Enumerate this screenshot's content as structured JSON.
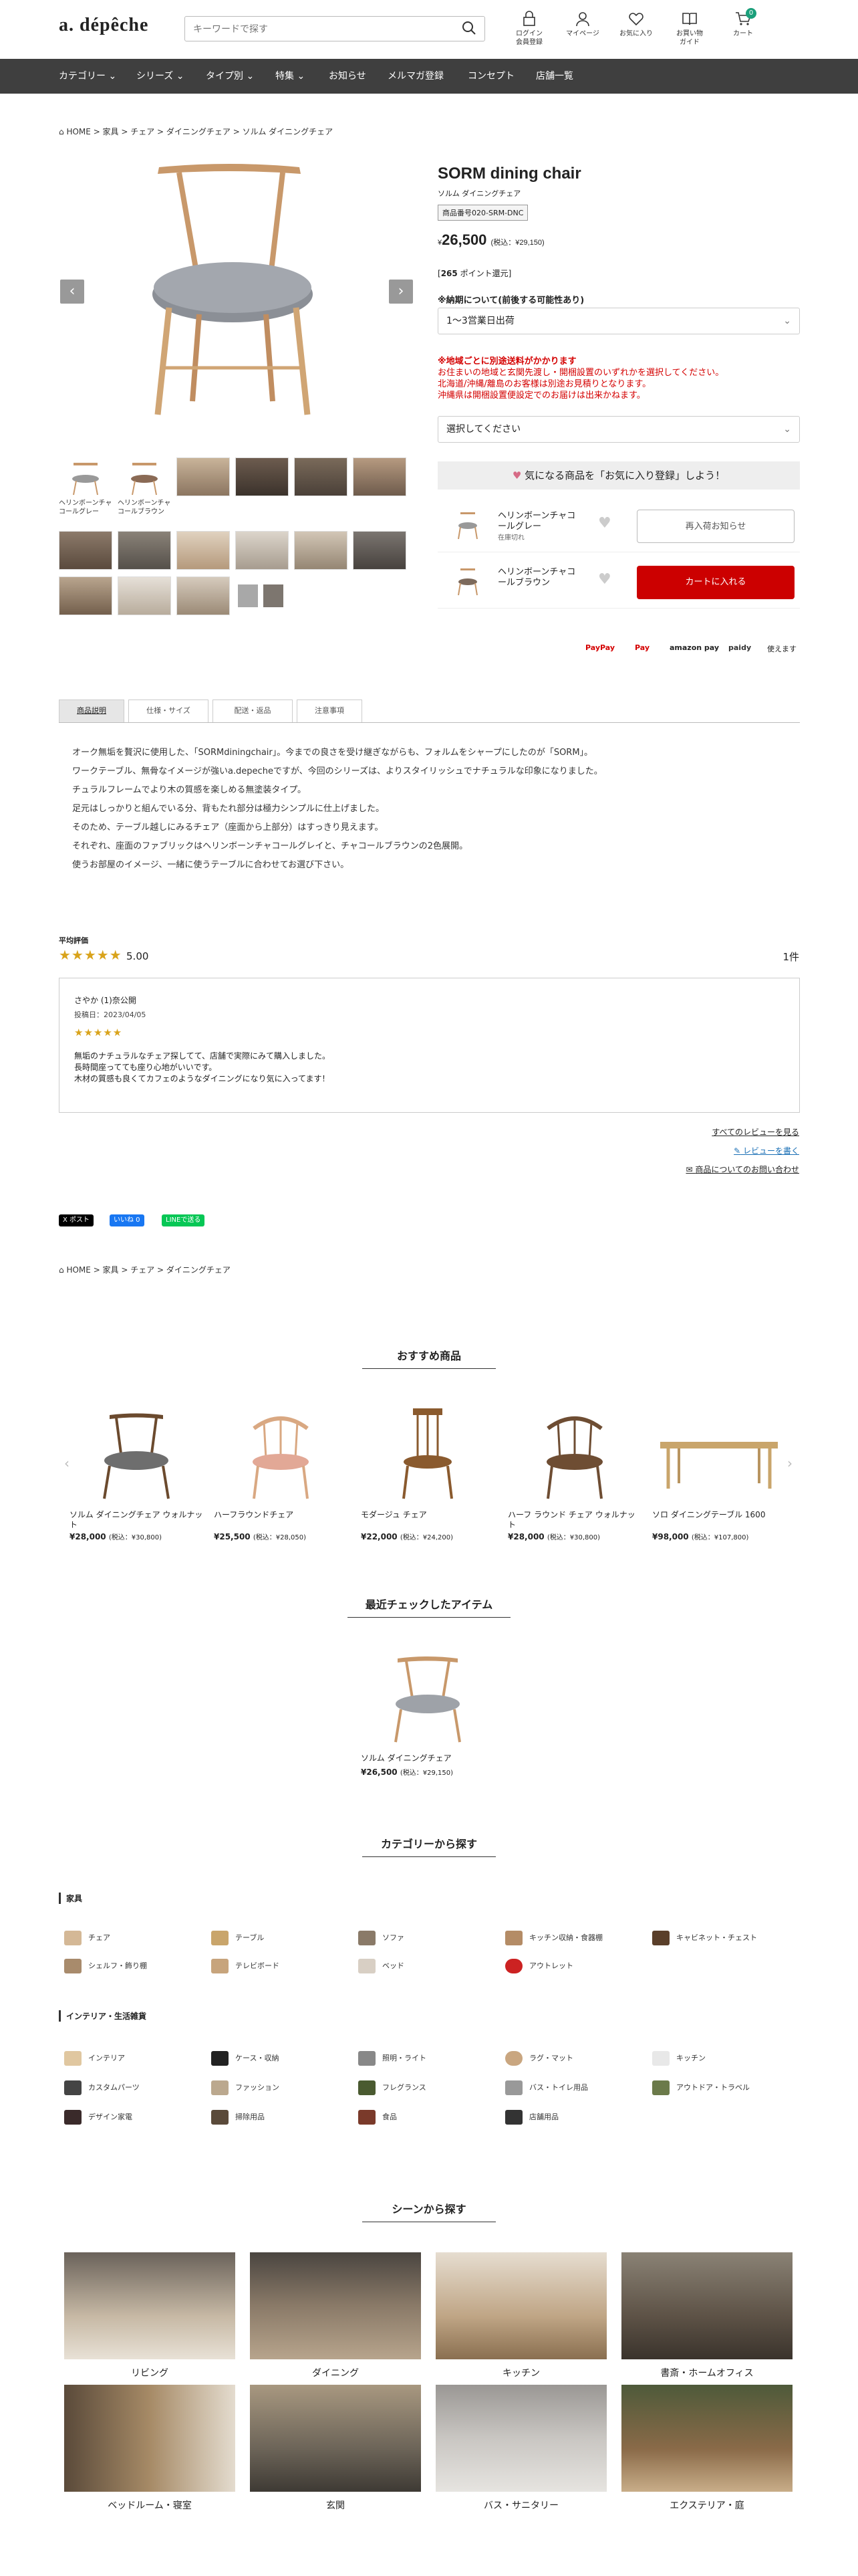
{
  "header": {
    "logo": "a. dépêche",
    "search_placeholder": "キーワードで探す",
    "icons": [
      {
        "label": "ログイン\n会員登録",
        "icon": "lock-icon"
      },
      {
        "label": "マイページ",
        "icon": "user-icon"
      },
      {
        "label": "お気に入り",
        "icon": "heart-icon"
      },
      {
        "label": "お買い物\nガイド",
        "icon": "book-icon"
      },
      {
        "label": "カート",
        "icon": "cart-icon"
      }
    ],
    "cart_count": "0"
  },
  "nav": [
    "カテゴリー",
    "シリーズ",
    "タイプ別",
    "特集",
    "お知らせ",
    "メルマガ登録",
    "コンセプト",
    "店舗一覧"
  ],
  "breadcrumb": {
    "home": "HOME",
    "items": "> 家具 > チェア > ダイニングチェア > ソルム ダイニングチェア"
  },
  "product": {
    "name": "SORM dining chair",
    "kana": "ソルム ダイニングチェア",
    "code": "商品番号020-SRM-DNC",
    "price_symbol": "¥",
    "price": "26,500",
    "price_tax": "(税込：¥29,150)",
    "points_num": "265",
    "points_label": "ポイント還元",
    "delivery_title": "※納期について(前後する可能性あり)",
    "delivery_value": "1〜3営業日出荷",
    "warn_title": "※地域ごとに別途送料がかかります",
    "warn_lines": [
      "お住まいの地域と玄関先渡し・開梱設置のいずれかを選択してください。",
      "北海道/沖縄/離島のお客様は別途お見積りとなります。",
      "沖縄県は開梱設置便設定でのお届けは出来かねます。"
    ],
    "option_placeholder": "選択してください",
    "fav_text": "気になる商品を「お気に入り登録」しよう！",
    "variants": [
      {
        "name": "ヘリンボーンチャコールグレー",
        "sub": "在庫切れ",
        "button": "再入荷お知らせ"
      },
      {
        "name": "ヘリンボーンチャコールブラウン",
        "sub": "",
        "button": "カートに入れる"
      }
    ],
    "payments": [
      "PayPay",
      "Pay",
      "amazon pay",
      "paidy",
      "使えます"
    ],
    "thumb_labels": [
      "ヘリンボーンチャコールグレー",
      "ヘリンボーンチャコールブラウン"
    ]
  },
  "tabs": [
    "商品説明",
    "仕様・サイズ",
    "配送・返品",
    "注意事項"
  ],
  "description": [
    "オーク無垢を贅沢に使用した、「SORMdiningchair」。今までの良さを受け継ぎながらも、フォルムをシャープにしたのが「SORM」。",
    "ワークテーブル、無骨なイメージが強いa.depecheですが、今回のシリーズは、よりスタイリッシュでナチュラルな印象になりました。",
    "チュラルフレームでより木の質感を楽しめる無塗装タイプ。",
    "足元はしっかりと組んでいる分、背もたれ部分は極力シンプルに仕上げました。",
    "そのため、テーブル越しにみるチェア（座面から上部分）はすっきり見えます。",
    "それぞれ、座面のファブリックはヘリンボーンチャコールグレイと、チャコールブラウンの2色展開。",
    "使うお部屋のイメージ、一緒に使うテーブルに合わせてお選び下さい。"
  ],
  "reviews": {
    "title": "平均評価",
    "stars": "★★★★★",
    "avg": "5.00",
    "count": "1件",
    "items": [
      {
        "author": "さやか (1)奈公開",
        "date": "投稿日：2023/04/05",
        "stars": "★★★★★",
        "body": [
          "無垢のナチュラルなチェア探してて、店舗で実際にみて購入しました。",
          "長時間座ってても座り心地がいいです。",
          "木材の質感も良くてカフェのようなダイニングになり気に入ってます！"
        ]
      }
    ],
    "links": [
      "すべてのレビューを見る",
      "レビューを書く",
      "商品についてのお問い合わせ"
    ]
  },
  "sns": [
    "X ポスト",
    "いいね 0",
    "LINEで送る"
  ],
  "breadcrumb2": "> 家具 > チェア > ダイニングチェア",
  "recommended": {
    "title": "おすすめ商品",
    "items": [
      {
        "name": "ソルム ダイニングチェア ウォルナット",
        "price": "¥28,000",
        "tax": "(税込：¥30,800)",
        "color": "#6b4a2e"
      },
      {
        "name": "ハーフラウンドチェア",
        "price": "¥25,500",
        "tax": "(税込：¥28,050)",
        "color": "#d9a882"
      },
      {
        "name": "モダージュ チェア",
        "price": "¥22,000",
        "tax": "(税込：¥24,200)",
        "color": "#8a5a2e"
      },
      {
        "name": "ハーフ ラウンド チェア ウォルナット",
        "price": "¥28,000",
        "tax": "(税込：¥30,800)",
        "color": "#6e4d33"
      },
      {
        "name": "ソロ ダイニングテーブル 1600",
        "price": "¥98,000",
        "tax": "(税込：¥107,800)",
        "color": "#c9a56b"
      }
    ]
  },
  "recent": {
    "title": "最近チェックしたアイテム",
    "name": "ソルム ダイニングチェア",
    "price": "¥26,500",
    "tax": "(税込：¥29,150)"
  },
  "categories": {
    "title": "カテゴリーから探す",
    "furniture_head": "家具",
    "furniture": [
      "チェア",
      "テーブル",
      "ソファ",
      "キッチン収納・食器棚",
      "キャビネット・チェスト",
      "シェルフ・飾り棚",
      "テレビボード",
      "ベッド",
      "アウトレット"
    ],
    "interior_head": "インテリア・生活雑貨",
    "interior": [
      "インテリア",
      "ケース・収納",
      "照明・ライト",
      "ラグ・マット",
      "キッチン",
      "カスタムパーツ",
      "ファッション",
      "フレグランス",
      "バス・トイレ用品",
      "アウトドア・トラベル",
      "デザイン家電",
      "掃除用品",
      "食品",
      "店舗用品"
    ]
  },
  "scenes": {
    "title": "シーンから探す",
    "items": [
      "リビング",
      "ダイニング",
      "キッチン",
      "書斎・ホームオフィス",
      "ベッドルーム・寝室",
      "玄関",
      "バス・サニタリー",
      "エクステリア・庭"
    ]
  },
  "colors": {
    "nav_bg": "#3f3f3f",
    "accent_red": "#cc0000",
    "badge_green": "#1a9f7a",
    "star": "#d9a31b"
  }
}
